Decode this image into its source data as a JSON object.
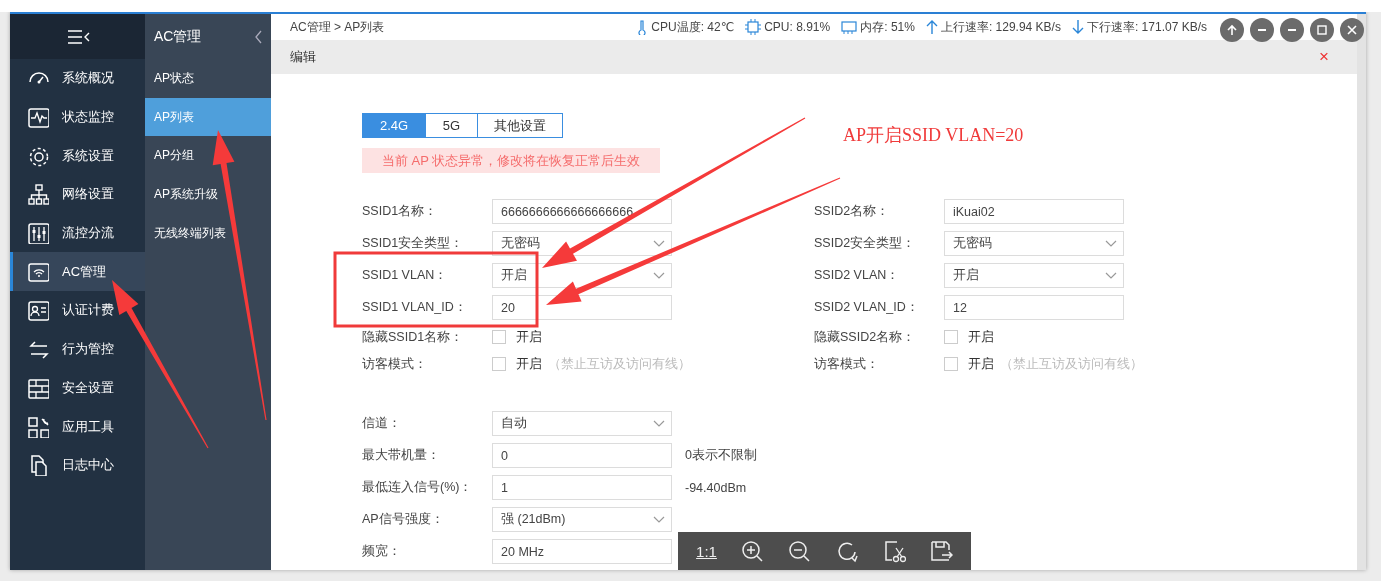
{
  "sidebar": {
    "items": [
      {
        "label": "系统概况",
        "selected": false
      },
      {
        "label": "状态监控",
        "selected": false
      },
      {
        "label": "系统设置",
        "selected": false
      },
      {
        "label": "网络设置",
        "selected": false
      },
      {
        "label": "流控分流",
        "selected": false
      },
      {
        "label": "AC管理",
        "selected": true
      },
      {
        "label": "认证计费",
        "selected": false
      },
      {
        "label": "行为管控",
        "selected": false
      },
      {
        "label": "安全设置",
        "selected": false
      },
      {
        "label": "应用工具",
        "selected": false
      },
      {
        "label": "日志中心",
        "selected": false
      }
    ]
  },
  "submenu": {
    "title": "AC管理",
    "items": [
      {
        "label": "AP状态",
        "selected": false
      },
      {
        "label": "AP列表",
        "selected": true
      },
      {
        "label": "AP分组",
        "selected": false
      },
      {
        "label": "AP系统升级",
        "selected": false
      },
      {
        "label": "无线终端列表",
        "selected": false
      }
    ]
  },
  "topbar": {
    "breadcrumb": "AC管理 > AP列表",
    "stats": [
      {
        "kind": "temperature",
        "text": "CPU温度: 42℃"
      },
      {
        "kind": "cpu",
        "text": "CPU: 8.91%"
      },
      {
        "kind": "memory",
        "text": "内存: 51%"
      },
      {
        "kind": "upload",
        "text": "上行速率: 129.94 KB/s"
      },
      {
        "kind": "download",
        "text": "下行速率: 171.07 KB/s"
      }
    ]
  },
  "dialog": {
    "title": "编辑",
    "close": "×",
    "tabs": [
      {
        "label": "2.4G",
        "selected": true
      },
      {
        "label": "5G",
        "selected": false
      },
      {
        "label": "其他设置",
        "selected": false
      }
    ],
    "alert": "当前 AP 状态异常，修改将在恢复正常后生效",
    "ssid1_fields": [
      {
        "kind": "input",
        "label": "SSID1名称：",
        "value": "6666666666666666666"
      },
      {
        "kind": "select",
        "label": "SSID1安全类型：",
        "value": "无密码"
      },
      {
        "kind": "select",
        "label": "SSID1 VLAN：",
        "value": "开启"
      },
      {
        "kind": "input",
        "label": "SSID1 VLAN_ID：",
        "value": "20"
      },
      {
        "kind": "checkbox",
        "label": "隐藏SSID1名称：",
        "checked": false,
        "text": "开启"
      },
      {
        "kind": "checkbox",
        "label": "访客模式：",
        "checked": false,
        "text": "开启",
        "note": "（禁止互访及访问有线）"
      }
    ],
    "ssid2_fields": [
      {
        "kind": "input",
        "label": "SSID2名称：",
        "value": "iKuai02"
      },
      {
        "kind": "select",
        "label": "SSID2安全类型：",
        "value": "无密码"
      },
      {
        "kind": "select",
        "label": "SSID2 VLAN：",
        "value": "开启"
      },
      {
        "kind": "input",
        "label": "SSID2 VLAN_ID：",
        "value": "12"
      },
      {
        "kind": "checkbox",
        "label": "隐藏SSID2名称：",
        "checked": false,
        "text": "开启"
      },
      {
        "kind": "checkbox",
        "label": "访客模式：",
        "checked": false,
        "text": "开启",
        "note": "（禁止互访及访问有线）"
      }
    ],
    "radio_fields": [
      {
        "kind": "select",
        "label": "信道：",
        "value": "自动"
      },
      {
        "kind": "input",
        "label": "最大带机量：",
        "value": "0",
        "note": "0表示不限制"
      },
      {
        "kind": "input",
        "label": "最低连入信号(%)：",
        "value": "1",
        "note": "-94.40dBm"
      },
      {
        "kind": "select",
        "label": "AP信号强度：",
        "value": "强 (21dBm)"
      },
      {
        "kind": "input",
        "label": "频宽：",
        "value": "20 MHz"
      }
    ]
  },
  "annotation": {
    "text": "AP开启SSID VLAN=20"
  },
  "image_viewer": {
    "zoom_label": "1:1"
  }
}
